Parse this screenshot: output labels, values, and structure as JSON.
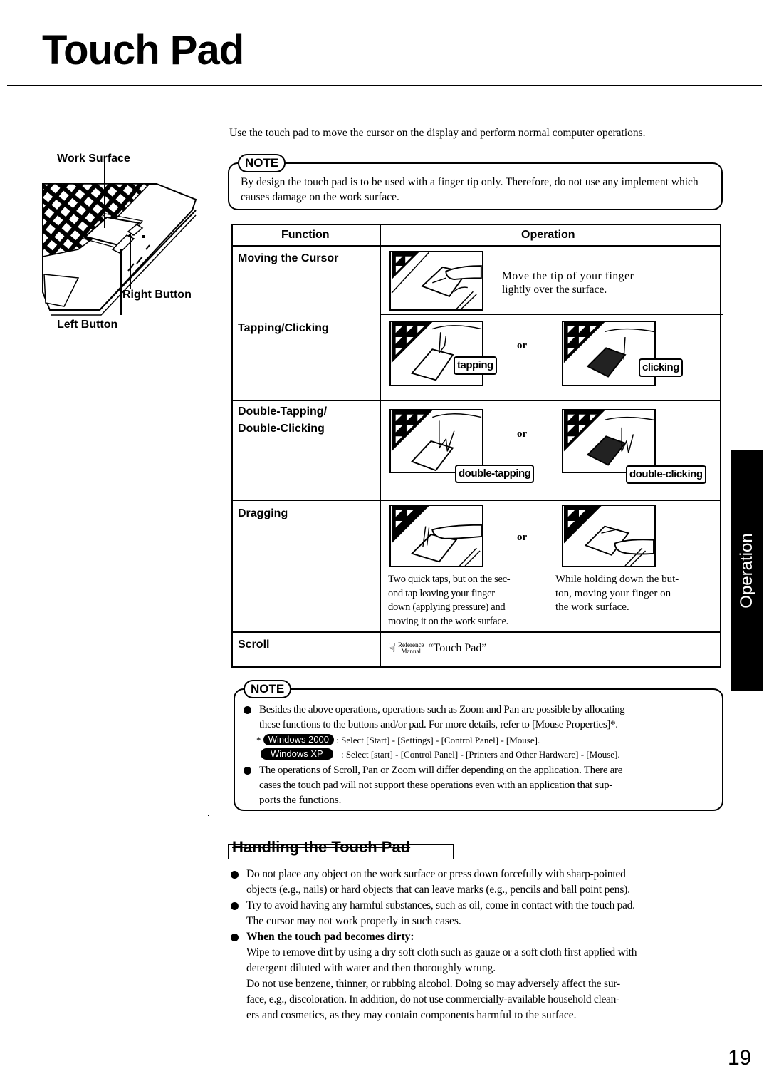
{
  "page": {
    "title": "Touch Pad",
    "page_number": "19",
    "side_tab": "Operation"
  },
  "intro": "Use the touch pad to move the cursor on the display and perform normal computer operations.",
  "figure": {
    "labels": {
      "work_surface": "Work Surface",
      "right_button": "Right Button",
      "left_button": "Left Button"
    }
  },
  "note1": {
    "tag": "NOTE",
    "text": "By design the touch pad is to be used with a finger tip only.  Therefore, do not use any implement which causes damage on the work surface."
  },
  "table": {
    "headers": {
      "function": "Function",
      "operation": "Operation"
    },
    "or_label": "or",
    "rows": [
      {
        "function": "Moving the Cursor",
        "text_line1": "Move the tip of your finger",
        "text_line2": "lightly over the surface."
      },
      {
        "function": "Tapping/Clicking",
        "tag_left": "tapping",
        "tag_right": "clicking"
      },
      {
        "function_line1": "Double-Tapping/",
        "function_line2": "Double-Clicking",
        "tag_left": "double-tapping",
        "tag_right": "double-clicking"
      },
      {
        "function": "Dragging",
        "left_text": [
          "Two quick taps, but on the sec-",
          "ond tap leaving your finger",
          "down (applying pressure) and",
          "moving it on the work surface."
        ],
        "right_text": [
          "While holding down the but-",
          "ton, moving your finger on",
          "the work surface."
        ]
      },
      {
        "function": "Scroll",
        "ref_label_top": "Reference",
        "ref_label_bottom": "Manual",
        "ref_text": "“Touch Pad”"
      }
    ]
  },
  "note2": {
    "tag": "NOTE",
    "bullet1_line1": "Besides the above operations, operations such as Zoom and Pan are possible by allocating",
    "bullet1_line2": "these functions to the buttons and/or pad. For more details, refer to [Mouse Properties]*.",
    "asterisk": "*",
    "win2000_badge": "Windows 2000",
    "win2000_text": ": Select [Start] - [Settings] - [Control Panel] - [Mouse].",
    "winxp_badge": "Windows XP",
    "winxp_text": ": Select [start] - [Control Panel] - [Printers and Other Hardware] - [Mouse].",
    "bullet2_line1": "The operations of Scroll, Pan or Zoom will differ depending on the application. There are",
    "bullet2_line2": "cases the touch pad will not support these operations even with an application that sup-",
    "bullet2_line3": "ports the functions."
  },
  "handling": {
    "heading": "Handling the Touch Pad",
    "items": [
      {
        "lines": [
          "Do not place any object on the work surface or press down forcefully with sharp-pointed",
          "objects (e.g., nails) or hard objects that can leave marks (e.g., pencils and ball point pens)."
        ]
      },
      {
        "lines": [
          "Try to avoid having any harmful substances, such as oil, come in contact with the touch pad.",
          "The cursor may not work properly in such cases."
        ]
      },
      {
        "heading": "When the touch pad becomes dirty:",
        "lines": [
          "Wipe to remove dirt by using a dry soft cloth such as gauze or a soft cloth first applied with",
          "detergent diluted with water and then thoroughly wrung.",
          "Do not use benzene, thinner, or rubbing alcohol.  Doing so may adversely affect the sur-",
          "face, e.g., discoloration.  In addition, do not use commercially-available household clean-",
          "ers and cosmetics, as they may contain components harmful to the surface."
        ]
      }
    ]
  }
}
